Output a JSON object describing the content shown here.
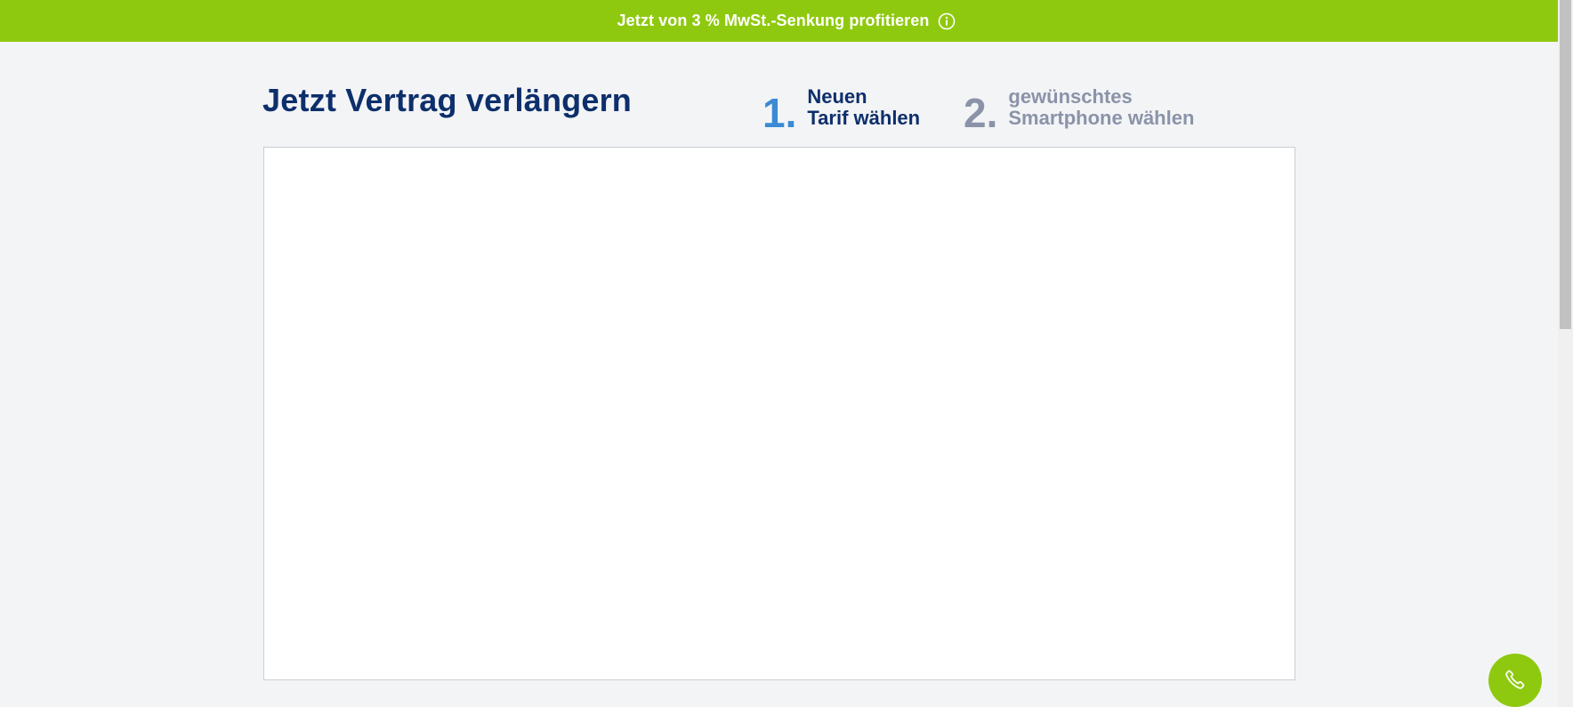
{
  "banner": {
    "text": "Jetzt von 3 % MwSt.-Senkung profitieren",
    "icon": "info-icon",
    "background_color": "#8fc90f"
  },
  "page": {
    "title": "Jetzt Vertrag verlängern"
  },
  "steps": [
    {
      "number": "1.",
      "line1": "Neuen",
      "line2": "Tarif wählen",
      "state": "active",
      "number_color": "#3a8ad4"
    },
    {
      "number": "2.",
      "line1": "gewünschtes",
      "line2": "Smartphone wählen",
      "state": "inactive",
      "number_color": "#8a93a8"
    }
  ],
  "call_button": {
    "icon": "phone-icon",
    "color": "#8fc90f"
  },
  "colors": {
    "title": "#0d2f6b",
    "page_background": "#f3f4f6"
  }
}
